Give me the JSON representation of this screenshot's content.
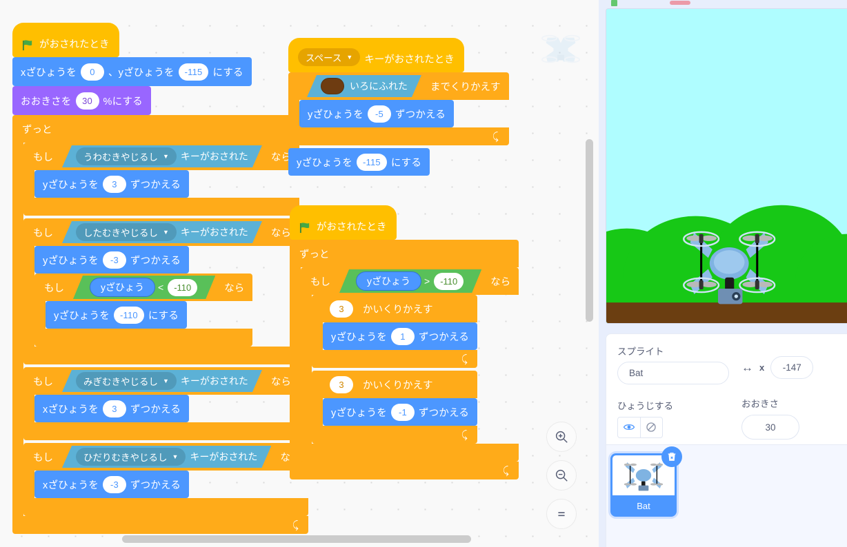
{
  "app": {
    "canvas_watermark_icon": "drone-icon"
  },
  "scripts": {
    "script1": {
      "hat": "がおされたとき",
      "hat_icon": "green-flag-icon",
      "goto_xy": {
        "x_label": "xざひょうを",
        "x_value": "0",
        "sep": "、",
        "y_label": "yざひょうを",
        "y_value": "-115",
        "suffix": "にする"
      },
      "set_size": {
        "label": "おおきさを",
        "value": "30",
        "suffix": "%にする"
      },
      "forever_label": "ずっと",
      "if1": {
        "if_label": "もし",
        "then_label": "なら",
        "key": "うわむきやじるし",
        "key_suffix": "キーがおされた",
        "body": {
          "label": "yざひょうを",
          "value": "3",
          "suffix": "ずつかえる"
        }
      },
      "if2": {
        "if_label": "もし",
        "then_label": "なら",
        "key": "したむきやじるし",
        "key_suffix": "キーがおされた",
        "body": {
          "label": "yざひょうを",
          "value": "-3",
          "suffix": "ずつかえる"
        },
        "nested_if": {
          "if_label": "もし",
          "then_label": "なら",
          "operand_left": "yざひょう",
          "operator": "<",
          "operand_right": "-110",
          "body": {
            "label": "yざひょうを",
            "value": "-110",
            "suffix": "にする"
          }
        }
      },
      "if3": {
        "if_label": "もし",
        "then_label": "なら",
        "key": "みぎむきやじるし",
        "key_suffix": "キーがおされた",
        "body": {
          "label": "xざひょうを",
          "value": "3",
          "suffix": "ずつかえる"
        }
      },
      "if4": {
        "if_label": "もし",
        "then_label": "なら",
        "key": "ひだりむきやじるし",
        "key_suffix": "キーがおされた",
        "body": {
          "label": "xざひょうを",
          "value": "-3",
          "suffix": "ずつかえる"
        }
      }
    },
    "script2": {
      "hat_key": "スペース",
      "hat_suffix": "キーがおされたとき",
      "repeat_until": {
        "color_swatch": "#6E3C11",
        "condition_label": "いろにふれた",
        "suffix": "までくりかえす"
      },
      "body": {
        "label": "yざひょうを",
        "value": "-5",
        "suffix": "ずつかえる"
      },
      "after": {
        "label": "yざひょうを",
        "value": "-115",
        "suffix": "にする"
      }
    },
    "script3": {
      "hat": "がおされたとき",
      "hat_icon": "green-flag-icon",
      "forever_label": "ずっと",
      "if": {
        "if_label": "もし",
        "then_label": "なら",
        "operand_left": "yざひょう",
        "operator": ">",
        "operand_right": "-110"
      },
      "repeat_a": {
        "value": "3",
        "suffix": "かいくりかえす",
        "body": {
          "label": "yざひょうを",
          "value": "1",
          "suffix": "ずつかえる"
        }
      },
      "repeat_b": {
        "value": "3",
        "suffix": "かいくりかえす",
        "body": {
          "label": "yざひょうを",
          "value": "-1",
          "suffix": "ずつかえる"
        }
      }
    }
  },
  "zoom_controls": {
    "zoom_in": "zoom-in-icon",
    "zoom_out": "zoom-out-icon",
    "zoom_reset": "zoom-reset-icon"
  },
  "stage": {
    "sky_color": "#AFFDFF",
    "hill_color": "#17C816",
    "ground_color": "#6B3E11",
    "sprite_icon": "drone-icon"
  },
  "sprite_info": {
    "title": "スプライト",
    "name_value": "Bat",
    "x_letter": "x",
    "x_value": "-147",
    "visible_label": "ひょうじする",
    "size_label": "おおきさ",
    "size_value": "30",
    "show_icon": "eye-icon",
    "hide_icon": "eye-slash-icon",
    "arrows_icon": "left-right-arrow-icon"
  },
  "sprite_list": {
    "items": [
      {
        "name": "Bat",
        "icon": "drone-icon",
        "delete_icon": "trash-icon",
        "selected": true
      }
    ]
  }
}
